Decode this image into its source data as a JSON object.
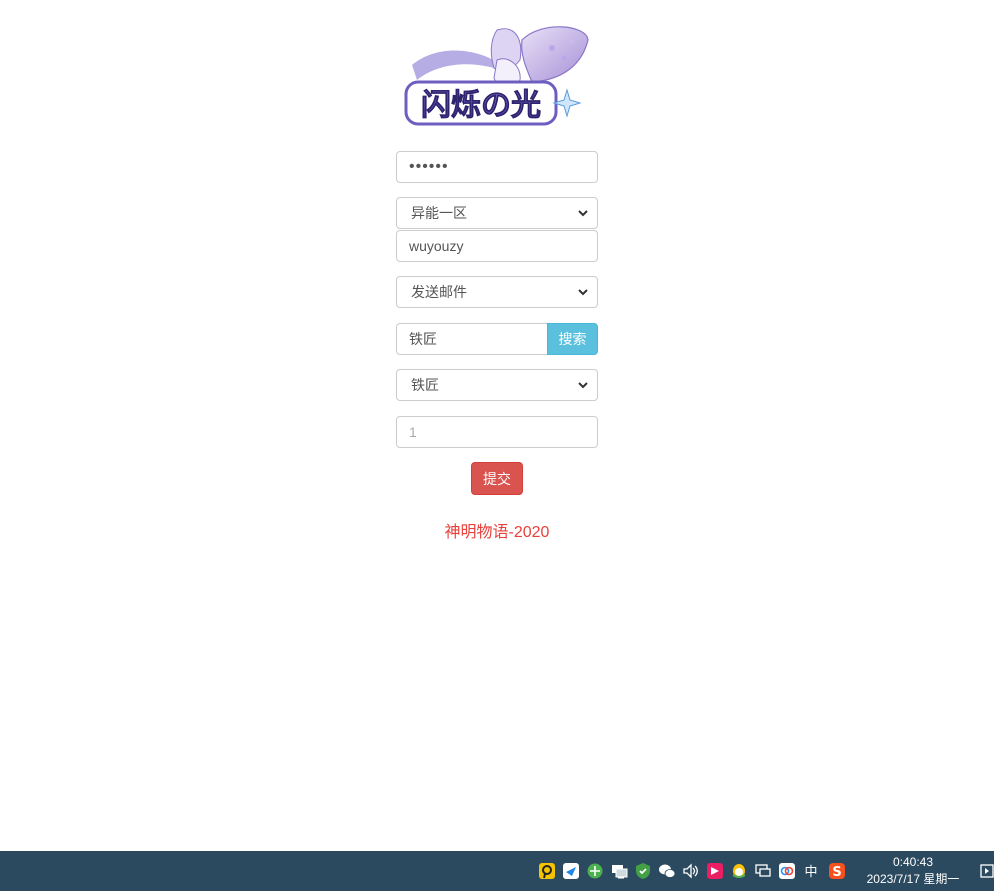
{
  "logo": {
    "text": "闪烁の光"
  },
  "form": {
    "password_value": "••••••",
    "server_select": "异能一区",
    "account_value": "wuyouzy",
    "action_select": "发送邮件",
    "search_value": "铁匠",
    "search_button": "搜索",
    "item_select": "铁匠",
    "quantity_placeholder": "1",
    "submit_button": "提交"
  },
  "footer": {
    "text": "神明物语-2020"
  },
  "taskbar": {
    "tray_icons": [
      "pin-app-icon",
      "feishu-icon",
      "browser-icon",
      "network-display-icon",
      "security-shield-icon",
      "wechat-icon",
      "volume-icon",
      "red-app-icon",
      "qq-icon",
      "network-icon",
      "baidu-netdisk-icon",
      "ime-icon",
      "sogou-icon"
    ],
    "ime_label": "中",
    "sogou_label": "S",
    "clock_time": "0:40:43",
    "clock_date": "2023/7/17 星期一"
  }
}
